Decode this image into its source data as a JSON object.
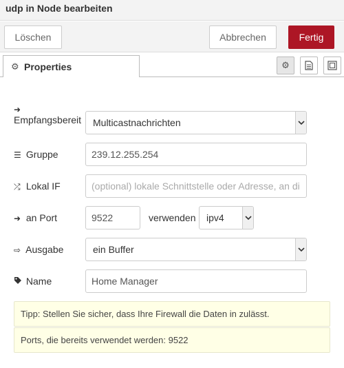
{
  "dialog": {
    "title": "udp in Node bearbeiten",
    "delete_label": "Löschen",
    "cancel_label": "Abbrechen",
    "done_label": "Fertig",
    "tab_label": "Properties"
  },
  "form": {
    "receive": {
      "label": "Empfangsbereit",
      "value": "Multicastnachrichten"
    },
    "group": {
      "label": "Gruppe",
      "value": "239.12.255.254"
    },
    "local_if": {
      "label": "Lokal IF",
      "placeholder": "(optional) lokale Schnittstelle oder Adresse, an di"
    },
    "port": {
      "label": "an Port",
      "value": "9522",
      "use_label": "verwenden",
      "ip_version": "ipv4"
    },
    "output": {
      "label": "Ausgabe",
      "value": "ein Buffer"
    },
    "name": {
      "label": "Name",
      "value": "Home Manager"
    }
  },
  "tips": {
    "firewall": "Tipp: Stellen Sie sicher, dass Ihre Firewall die Daten in zulässt.",
    "ports_in_use": "Ports, die bereits verwendet werden: 9522"
  },
  "colors": {
    "done_button": "#ad1625",
    "tip_background": "#ffffe6"
  }
}
